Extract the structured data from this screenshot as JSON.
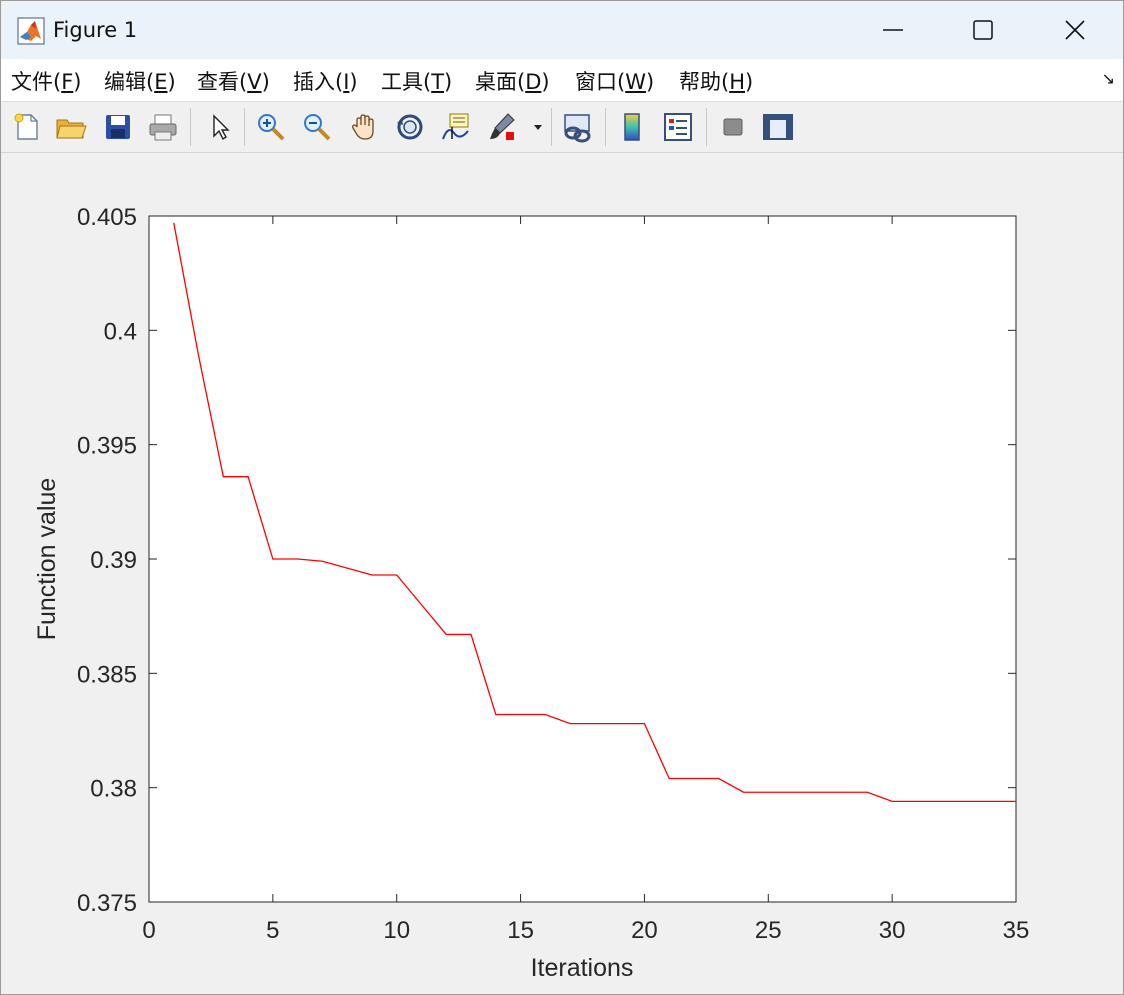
{
  "window": {
    "title": "Figure 1",
    "icon": "matlab-logo-icon"
  },
  "menu": {
    "items": [
      {
        "label": "文件(",
        "key": "F",
        "end": ")"
      },
      {
        "label": "编辑(",
        "key": "E",
        "end": ")"
      },
      {
        "label": "查看(",
        "key": "V",
        "end": ")"
      },
      {
        "label": "插入(",
        "key": "I",
        "end": ")"
      },
      {
        "label": "工具(",
        "key": "T",
        "end": ")"
      },
      {
        "label": "桌面(",
        "key": "D",
        "end": ")"
      },
      {
        "label": "窗口(",
        "key": "W",
        "end": ")"
      },
      {
        "label": "帮助(",
        "key": "H",
        "end": ")"
      }
    ],
    "expand_glyph": "↘"
  },
  "toolbar": {
    "buttons": [
      "new-figure-icon",
      "open-file-icon",
      "save-icon",
      "print-icon",
      "pointer-icon",
      "zoom-in-icon",
      "zoom-out-icon",
      "pan-icon",
      "rotate-3d-icon",
      "data-cursor-icon",
      "brush-icon",
      "link-plot-icon",
      "colorbar-icon",
      "legend-icon",
      "hide-plot-tools-icon",
      "show-plot-tools-icon"
    ]
  },
  "chart_data": {
    "type": "line",
    "xlabel": "Iterations",
    "ylabel": "Function value",
    "xlim": [
      0,
      35
    ],
    "ylim": [
      0.375,
      0.405
    ],
    "xticks": [
      "0",
      "5",
      "10",
      "15",
      "20",
      "25",
      "30",
      "35"
    ],
    "yticks": [
      "0.375",
      "0.38",
      "0.385",
      "0.39",
      "0.395",
      "0.4",
      "0.405"
    ],
    "grid": false,
    "series": [
      {
        "color": "#ff0000",
        "x": [
          1,
          2,
          3,
          4,
          5,
          6,
          7,
          8,
          9,
          10,
          11,
          12,
          13,
          14,
          15,
          16,
          17,
          18,
          19,
          20,
          21,
          22,
          23,
          24,
          25,
          26,
          27,
          28,
          29,
          30,
          31,
          32,
          33,
          34,
          35
        ],
        "values": [
          0.4047,
          0.3989,
          0.3936,
          0.3936,
          0.39,
          0.39,
          0.3899,
          0.3896,
          0.3893,
          0.3893,
          0.388,
          0.3867,
          0.3867,
          0.3832,
          0.3832,
          0.3832,
          0.3828,
          0.3828,
          0.3828,
          0.3828,
          0.3804,
          0.3804,
          0.3804,
          0.3798,
          0.3798,
          0.3798,
          0.3798,
          0.3798,
          0.3798,
          0.3794,
          0.3794,
          0.3794,
          0.3794,
          0.3794,
          0.3794
        ]
      }
    ]
  }
}
